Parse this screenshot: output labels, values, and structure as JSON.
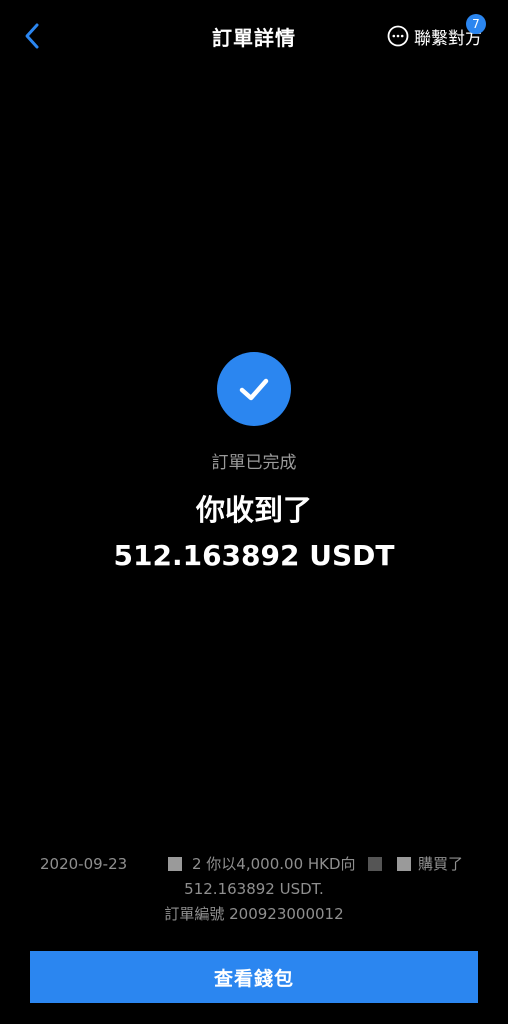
{
  "header": {
    "title": "訂單詳情",
    "contact_label": "聯繫對方",
    "unread_count": "7"
  },
  "status": {
    "label": "訂單已完成",
    "received": "你收到了",
    "amount": "512.163892 USDT"
  },
  "details": {
    "date": "2020-09-23",
    "description": "2 你以4,000.00 HKD向",
    "purchased": "購買了",
    "amount": "512.163892 USDT.",
    "order_number": "訂單編號 200923000012"
  },
  "actions": {
    "view_wallet": "查看錢包"
  },
  "colors": {
    "accent": "#2b86f0",
    "background": "#000000",
    "muted_text": "#9a9a9a"
  },
  "icons": {
    "back": "chevron-left-icon",
    "contact": "chat-bubble-icon",
    "status": "check-icon"
  }
}
